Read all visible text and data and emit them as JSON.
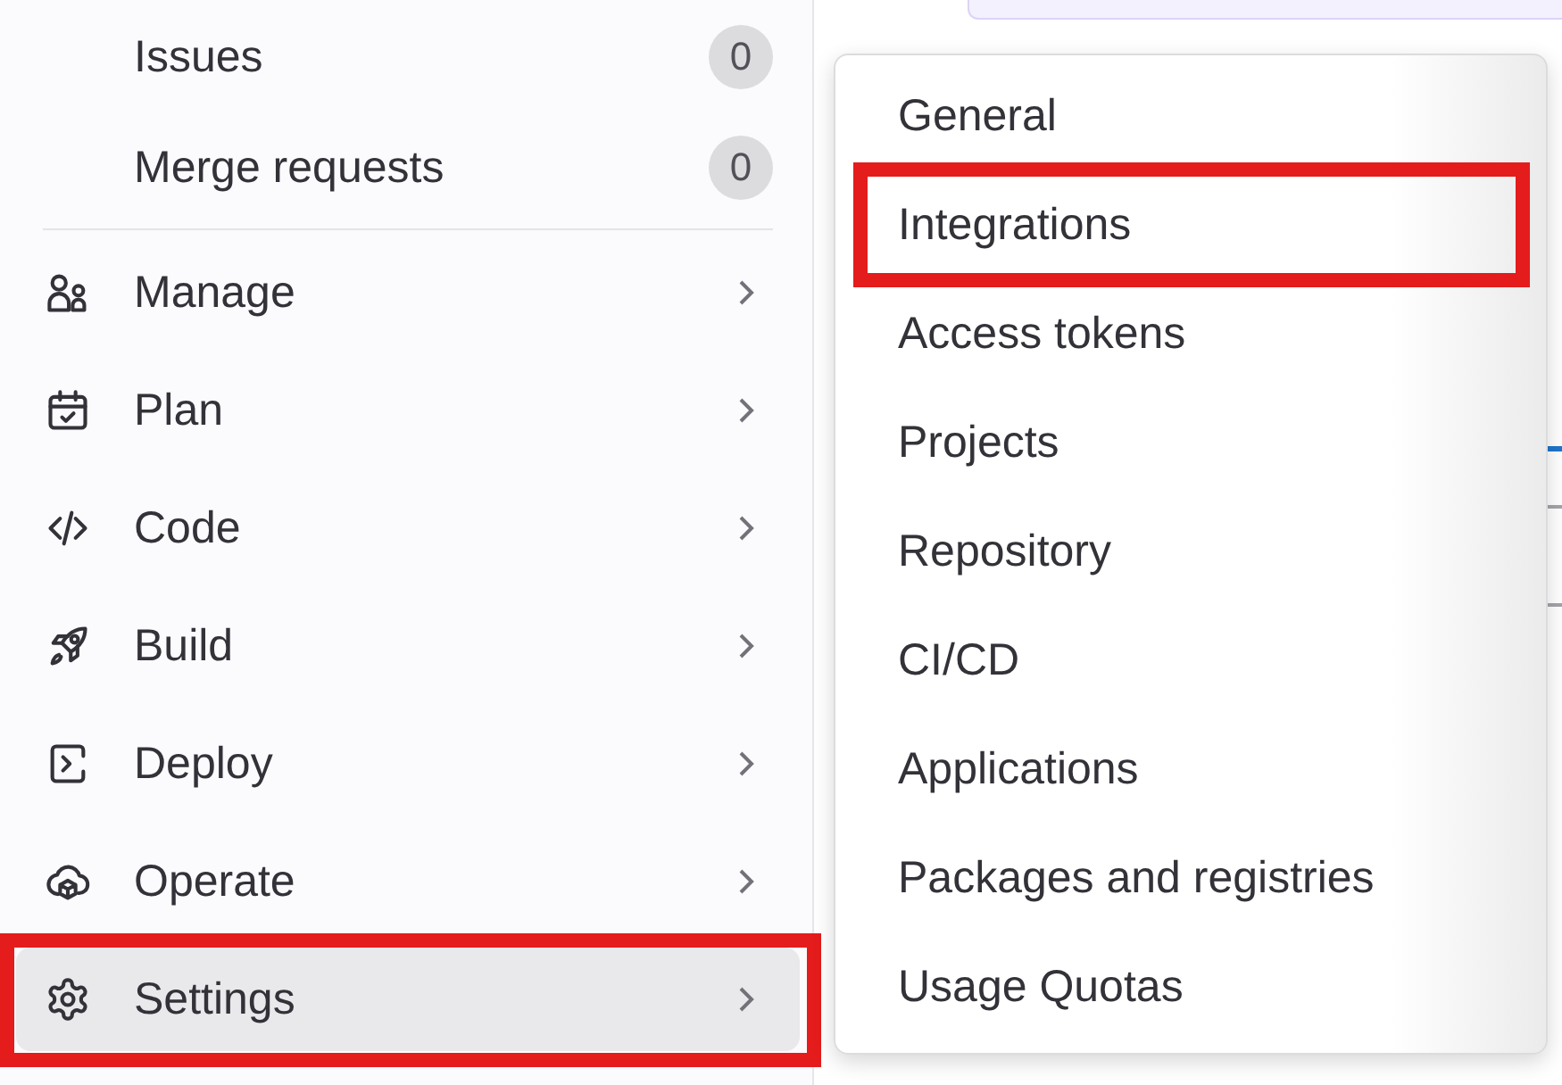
{
  "sidebar": {
    "groups": [
      {
        "items": [
          {
            "kind": "count",
            "label": "Issues",
            "count": "0",
            "selected": false,
            "highlighted": false
          },
          {
            "kind": "count",
            "label": "Merge requests",
            "count": "0",
            "selected": false,
            "highlighted": false
          }
        ]
      },
      {
        "items": [
          {
            "kind": "section",
            "label": "Manage",
            "selected": false,
            "highlighted": false
          },
          {
            "kind": "section",
            "label": "Plan",
            "selected": false,
            "highlighted": false
          },
          {
            "kind": "section",
            "label": "Code",
            "selected": false,
            "highlighted": false
          },
          {
            "kind": "section",
            "label": "Build",
            "selected": false,
            "highlighted": false
          },
          {
            "kind": "section",
            "label": "Deploy",
            "selected": false,
            "highlighted": false
          },
          {
            "kind": "section",
            "label": "Operate",
            "selected": false,
            "highlighted": false
          },
          {
            "kind": "section",
            "label": "Settings",
            "selected": true,
            "highlighted": true
          }
        ]
      }
    ]
  },
  "settings_menu": {
    "items": [
      {
        "label": "General",
        "selected": false,
        "highlighted": false
      },
      {
        "label": "Integrations",
        "selected": false,
        "highlighted": true
      },
      {
        "label": "Access tokens",
        "selected": false,
        "highlighted": false
      },
      {
        "label": "Projects",
        "selected": false,
        "highlighted": false
      },
      {
        "label": "Repository",
        "selected": false,
        "highlighted": false
      },
      {
        "label": "CI/CD",
        "selected": false,
        "highlighted": false
      },
      {
        "label": "Applications",
        "selected": false,
        "highlighted": false
      },
      {
        "label": "Packages and registries",
        "selected": false,
        "highlighted": false
      },
      {
        "label": "Usage Quotas",
        "selected": false,
        "highlighted": false
      }
    ]
  }
}
